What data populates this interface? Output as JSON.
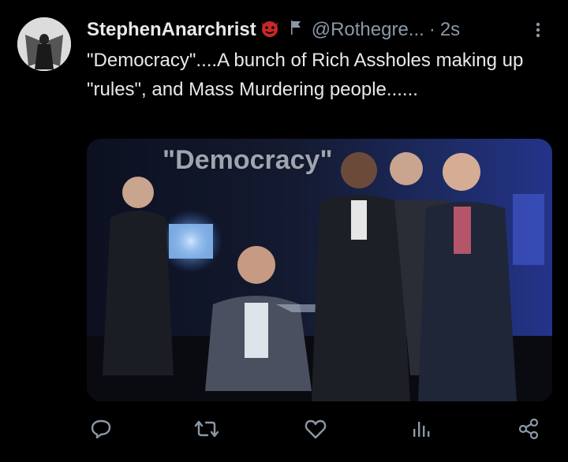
{
  "tweet": {
    "display_name": "StephenAnarchrist",
    "handle": "@Rothegre...",
    "separator": "·",
    "time": "2s",
    "text": "\"Democracy\"....A bunch of Rich Assholes making up \"rules\", and Mass Murdering people......",
    "image_caption": "\"Democracy\""
  },
  "icons": {
    "badge": "devil-emoji-icon",
    "flag": "flag-icon",
    "more": "more-vertical-icon",
    "reply": "reply-icon",
    "retweet": "retweet-icon",
    "like": "like-icon",
    "views": "views-icon",
    "share": "share-icon"
  },
  "colors": {
    "background": "#000000",
    "text_primary": "#e7e9ea",
    "text_secondary": "#8b98a5",
    "icon": "#71767b"
  }
}
